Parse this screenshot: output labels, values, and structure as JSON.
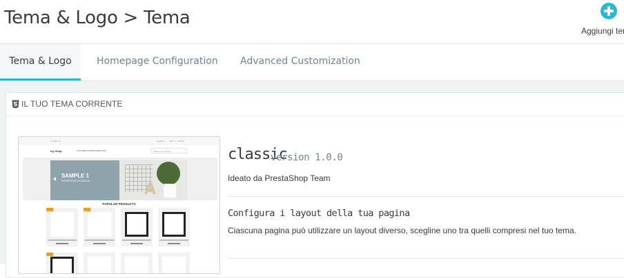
{
  "header": {
    "title": "Tema & Logo > Tema",
    "add_button_label": "Aggiungi tema"
  },
  "tabs": [
    {
      "label": "Tema & Logo",
      "active": true
    },
    {
      "label": "Homepage Configuration",
      "active": false
    },
    {
      "label": "Advanced Customization",
      "active": false
    }
  ],
  "panel": {
    "title": "IL TUO TEMA CORRENTE",
    "icon": "html5-icon"
  },
  "preview": {
    "topbar_left": "Contact us",
    "topbar_lang": "English ▾",
    "topbar_signin": "Sign in",
    "topbar_cart": "Cart (0)",
    "logo": "my shop",
    "nav_items": "CLOTHES   ACCESSORIES   ART",
    "search_placeholder": "Search our catalog",
    "slide_title": "SAMPLE 1",
    "slide_subtitle": "EXCEPTEUR OCCAECAT",
    "popular_heading": "POPULAR PRODUCTS"
  },
  "theme": {
    "name": "classic",
    "version": "version 1.0.0",
    "author": "Ideato da PrestaShop Team"
  },
  "layout": {
    "title": "Configura i layout della tua pagina",
    "description": "Ciascuna pagina può utilizzare un layout diverso, scegline uno tra quelli compresi nel tuo tema."
  },
  "colors": {
    "accent": "#25b9d7",
    "text": "#363a41",
    "muted": "#6c868e",
    "background": "#eff1f2"
  }
}
